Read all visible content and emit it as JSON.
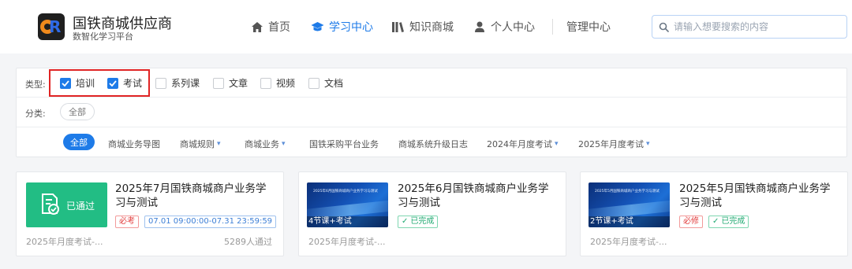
{
  "brand": {
    "title": "国铁商城供应商",
    "subtitle": "数智化学习平台"
  },
  "nav": [
    {
      "label": "首页",
      "icon": "home-icon",
      "active": false
    },
    {
      "label": "学习中心",
      "icon": "graduation-cap-icon",
      "active": true
    },
    {
      "label": "知识商城",
      "icon": "library-icon",
      "active": false
    },
    {
      "label": "个人中心",
      "icon": "user-icon",
      "active": false
    },
    {
      "label": "管理中心",
      "icon": "",
      "active": false
    }
  ],
  "search": {
    "placeholder": "请输入想要搜索的内容",
    "value": ""
  },
  "filter": {
    "type_label": "类型:",
    "types": [
      {
        "label": "培训",
        "checked": true
      },
      {
        "label": "考试",
        "checked": true
      },
      {
        "label": "系列课",
        "checked": false
      },
      {
        "label": "文章",
        "checked": false
      },
      {
        "label": "视频",
        "checked": false
      },
      {
        "label": "文档",
        "checked": false
      }
    ],
    "category_label": "分类:",
    "category_all": "全部",
    "sub_all": "全部",
    "subcategories": [
      {
        "label": "商城业务导图",
        "has_dropdown": false
      },
      {
        "label": "商城规则",
        "has_dropdown": true
      },
      {
        "label": "商城业务",
        "has_dropdown": true
      },
      {
        "label": "国铁采购平台业务",
        "has_dropdown": false
      },
      {
        "label": "商城系统升级日志",
        "has_dropdown": false
      },
      {
        "label": "2024年月度考试",
        "has_dropdown": true
      },
      {
        "label": "2025年月度考试",
        "has_dropdown": true
      }
    ]
  },
  "cards": [
    {
      "thumb_type": "status",
      "status": "已通过",
      "title": "2025年7月国铁商城商户业务学习与测试",
      "tags": [
        {
          "text": "必考",
          "color": "red",
          "check": false
        },
        {
          "text": "07.01 09:00:00-07.31 23:59:59",
          "color": "blue",
          "check": false
        }
      ],
      "category": "2025年月度考试-...",
      "stat": "5289人通过"
    },
    {
      "thumb_type": "banner",
      "thumb_title": "2025年6月国铁商城商户业务学习与测试",
      "thumb_caption": "4节课+考试",
      "title": "2025年6月国铁商城商户业务学习与测试",
      "tags": [
        {
          "text": "已完成",
          "color": "green",
          "check": true
        }
      ],
      "category": "2025年月度考试-...",
      "stat": ""
    },
    {
      "thumb_type": "banner",
      "thumb_title": "2025年5月国铁商城商户业务学习与测试",
      "thumb_caption": "2节课+考试",
      "title": "2025年5月国铁商城商户业务学习与测试",
      "tags": [
        {
          "text": "必修",
          "color": "red",
          "check": false
        },
        {
          "text": "已完成",
          "color": "green",
          "check": true
        }
      ],
      "category": "2025年月度考试-...",
      "stat": ""
    }
  ],
  "colors": {
    "accent": "#1e7be8",
    "pass_green": "#22bd84",
    "highlight_red": "#e02424"
  }
}
